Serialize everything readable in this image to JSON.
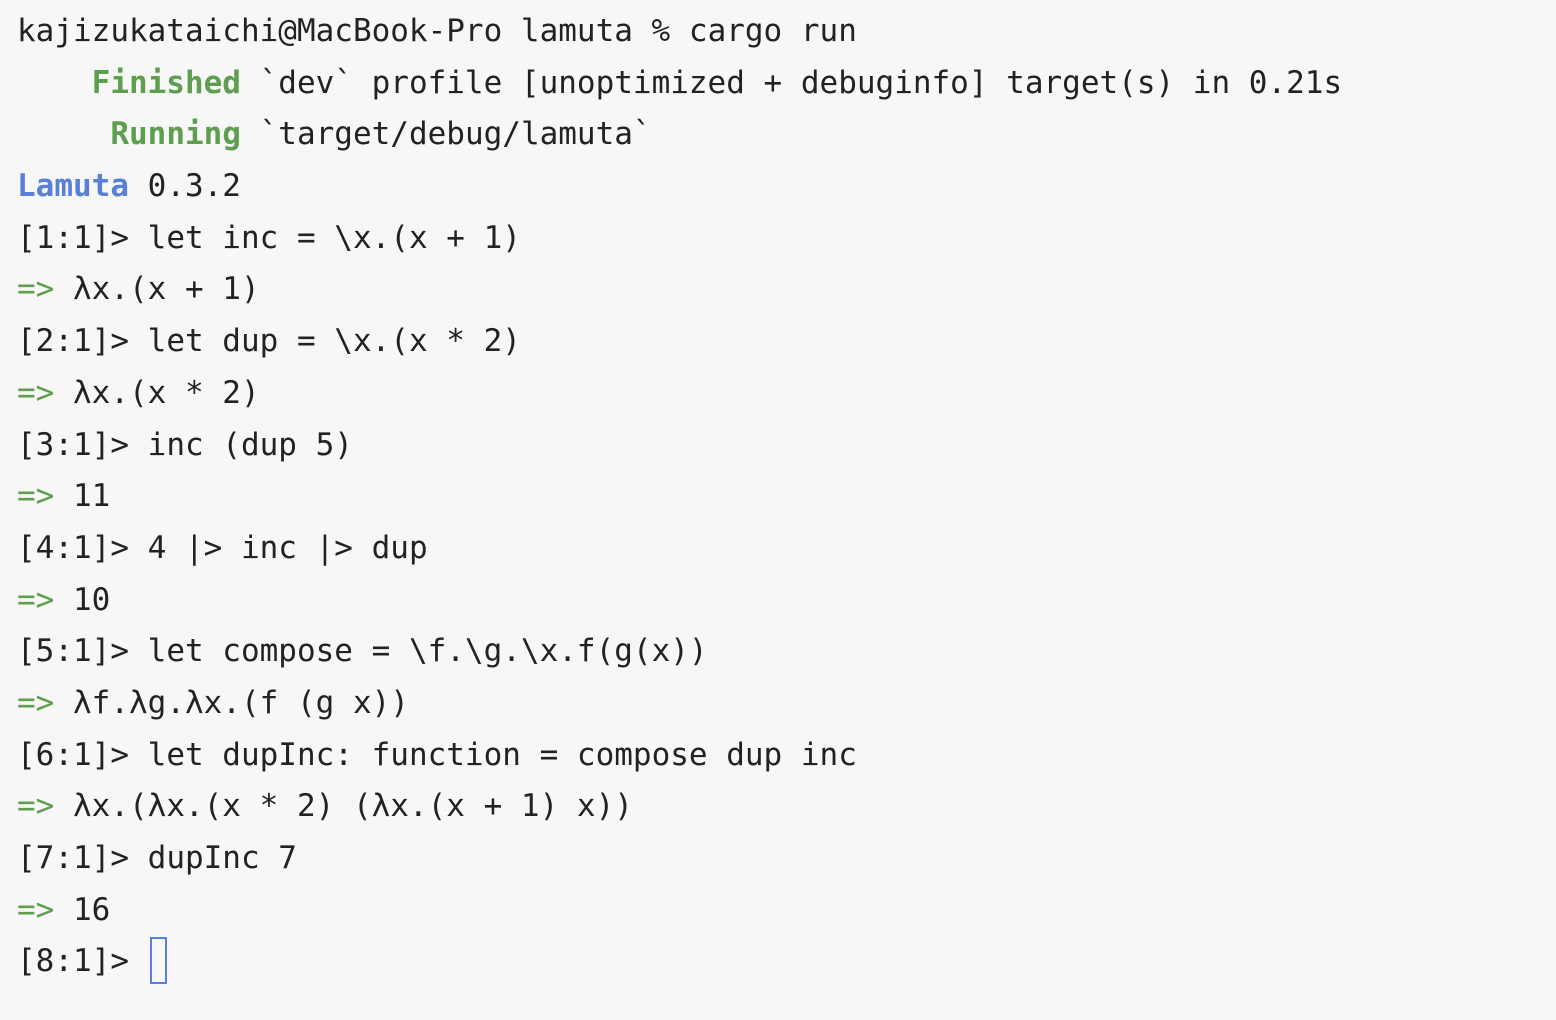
{
  "shell": {
    "prompt": "kajizukataichi@MacBook-Pro lamuta %",
    "command": "cargo run"
  },
  "cargo": {
    "finished_indent": "    ",
    "finished_label": "Finished",
    "finished_text": " `dev` profile [unoptimized + debuginfo] target(s) in 0.21s",
    "running_indent": "     ",
    "running_label": "Running",
    "running_text": " `target/debug/lamuta`"
  },
  "banner": {
    "name": "Lamuta",
    "version": "0.3.2"
  },
  "result_arrow": "=>",
  "entries": [
    {
      "prompt": "[1:1]>",
      "input": "let inc = \\x.(x + 1)",
      "output": "λx.(x + 1)"
    },
    {
      "prompt": "[2:1]>",
      "input": "let dup = \\x.(x * 2)",
      "output": "λx.(x * 2)"
    },
    {
      "prompt": "[3:1]>",
      "input": "inc (dup 5)",
      "output": "11"
    },
    {
      "prompt": "[4:1]>",
      "input": "4 |> inc |> dup",
      "output": "10"
    },
    {
      "prompt": "[5:1]>",
      "input": "let compose = \\f.\\g.\\x.f(g(x))",
      "output": "λf.λg.λx.(f (g x))"
    },
    {
      "prompt": "[6:1]>",
      "input": "let dupInc: function = compose dup inc",
      "output": "λx.(λx.(x * 2) (λx.(x + 1) x))"
    },
    {
      "prompt": "[7:1]>",
      "input": "dupInc 7",
      "output": "16"
    }
  ],
  "current_prompt": "[8:1]>",
  "current_input": "",
  "colors": {
    "background": "#f7f7f7",
    "text": "#222222",
    "cargo_green": "#5e9e4f",
    "lamuta_blue": "#5a7fd8",
    "cursor": "#5a7fd8"
  }
}
